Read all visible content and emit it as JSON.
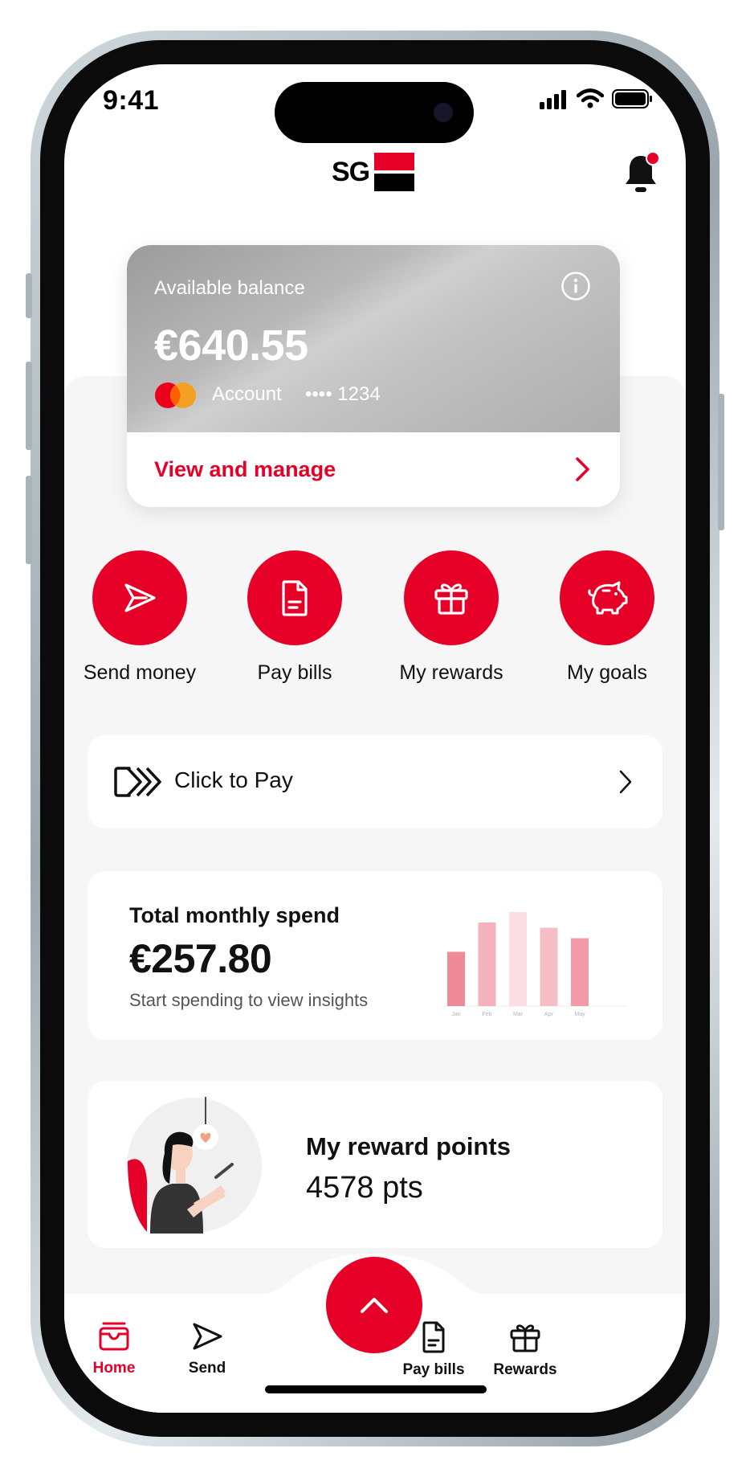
{
  "status_bar": {
    "time": "9:41"
  },
  "header": {
    "logo_text": "SG",
    "notification_dot": true
  },
  "balance_card": {
    "label": "Available balance",
    "amount": "€640.55",
    "account_label": "Account",
    "account_number": "•••• 1234",
    "action_label": "View and manage"
  },
  "quick_actions": [
    {
      "label": "Send money",
      "icon": "send-icon"
    },
    {
      "label": "Pay bills",
      "icon": "document-icon"
    },
    {
      "label": "My rewards",
      "icon": "gift-icon"
    },
    {
      "label": "My goals",
      "icon": "piggy-bank-icon"
    }
  ],
  "click_to_pay": {
    "label": "Click to Pay"
  },
  "spend_card": {
    "title": "Total monthly spend",
    "amount": "€257.80",
    "subtitle": "Start spending to view insights"
  },
  "chart_data": {
    "type": "bar",
    "categories": [
      "Jan",
      "Feb",
      "Mar",
      "Apr",
      "May"
    ],
    "values": [
      52,
      80,
      90,
      75,
      65
    ],
    "colors": [
      "#ef8a99",
      "#f4b2bc",
      "#fbdde2",
      "#f5bec6",
      "#f29aa7"
    ],
    "title": "",
    "xlabel": "",
    "ylabel": "",
    "ylim": [
      0,
      100
    ]
  },
  "rewards_card": {
    "title": "My reward points",
    "points": "4578 pts"
  },
  "tab_bar": {
    "items": [
      {
        "label": "Home",
        "icon": "home-icon",
        "active": true
      },
      {
        "label": "Send",
        "icon": "send-icon",
        "active": false
      },
      {
        "label": "Pay bills",
        "icon": "document-icon",
        "active": false
      },
      {
        "label": "Rewards",
        "icon": "gift-icon",
        "active": false
      }
    ],
    "center_action_icon": "chevron-up-icon"
  },
  "colors": {
    "accent": "#e60028",
    "background": "#f6f6f6",
    "card": "#ffffff",
    "text": "#111111"
  }
}
